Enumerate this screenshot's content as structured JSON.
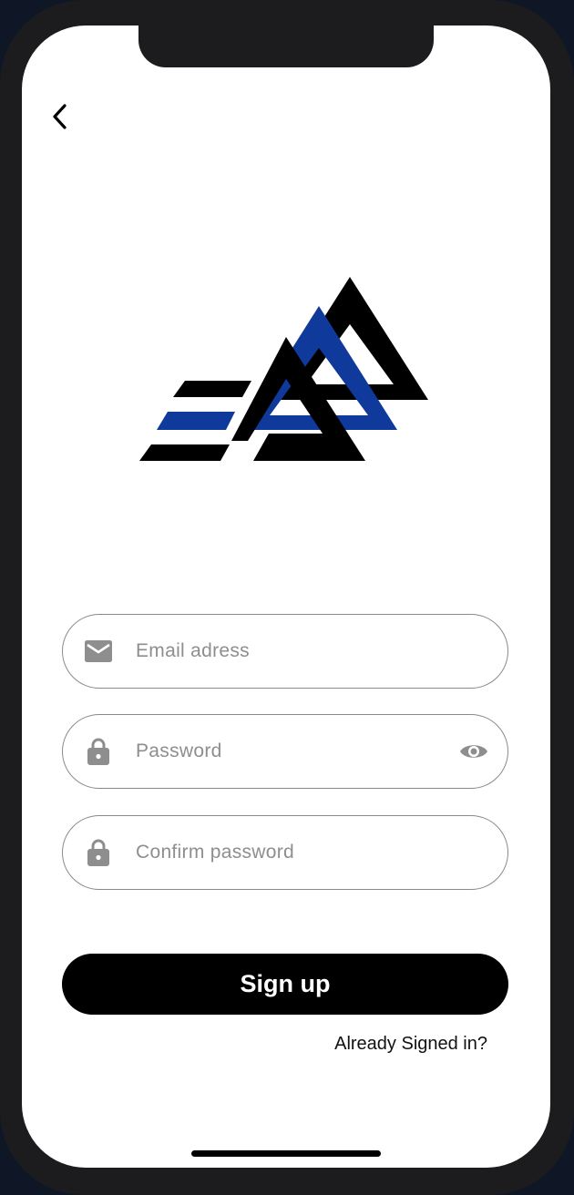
{
  "colors": {
    "logo_black": "#000000",
    "logo_blue": "#0f3a9c",
    "icon_gray": "#8e8e8e",
    "primary_button": "#000000"
  },
  "navigation": {
    "back_icon": "chevron-left-icon"
  },
  "logo": {
    "icon": "triangles-logo"
  },
  "form": {
    "email": {
      "placeholder": "Email adress",
      "icon": "mail-icon"
    },
    "password": {
      "placeholder": "Password",
      "icon": "lock-icon",
      "toggle_icon": "eye-icon"
    },
    "confirm_password": {
      "placeholder": "Confirm password",
      "icon": "lock-icon"
    }
  },
  "actions": {
    "signup_label": "Sign up",
    "signin_link": "Already Signed in?"
  }
}
